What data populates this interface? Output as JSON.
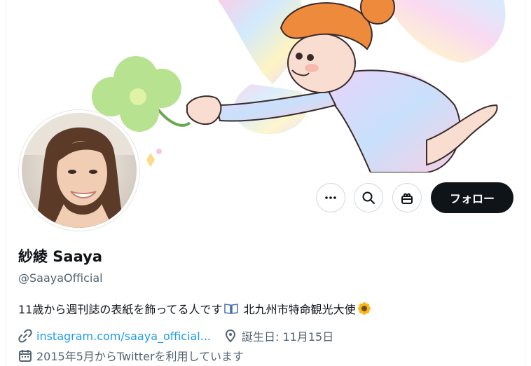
{
  "profile": {
    "display_name": "紗綾 Saaya",
    "handle": "@SaayaOfficial",
    "bio_text": "11歳から週刊誌の表紙を飾ってる人です",
    "bio_suffix": "北九州市特命観光大使",
    "website": "instagram.com/saaya_official...",
    "birthday": "誕生日: 11月15日",
    "joined": "2015年5月からTwitterを利用しています"
  },
  "actions": {
    "follow_label": "フォロー",
    "more_icon": "more-icon",
    "search_icon": "search-icon",
    "gift_icon": "gift-icon"
  },
  "colors": {
    "follow_bg": "#0f1419",
    "link": "#1d9bf0",
    "secondary_text": "#536471"
  }
}
